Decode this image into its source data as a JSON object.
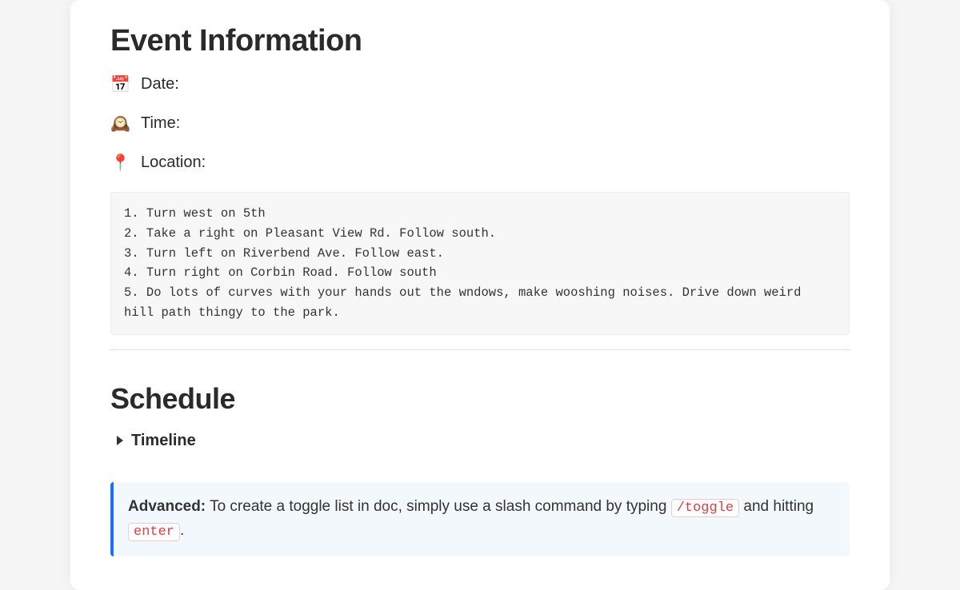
{
  "event_info": {
    "heading": "Event Information",
    "rows": [
      {
        "emoji": "📅",
        "label": "Date:"
      },
      {
        "emoji": "🕰️",
        "label": "Time:"
      },
      {
        "emoji": "📍",
        "label": "Location:"
      }
    ],
    "directions": "1. Turn west on 5th\n2. Take a right on Pleasant View Rd. Follow south.\n3. Turn left on Riverbend Ave. Follow east.\n4. Turn right on Corbin Road. Follow south\n5. Do lots of curves with your hands out the wndows, make wooshing noises. Drive down weird hill path thingy to the park."
  },
  "schedule": {
    "heading": "Schedule",
    "toggle_label": "Timeline"
  },
  "callout": {
    "strong": "Advanced:",
    "text_before": " To create a toggle list in doc, simply use a slash command by typing ",
    "code1": "/toggle",
    "text_middle": " and hitting ",
    "code2": "enter",
    "text_after": "."
  }
}
